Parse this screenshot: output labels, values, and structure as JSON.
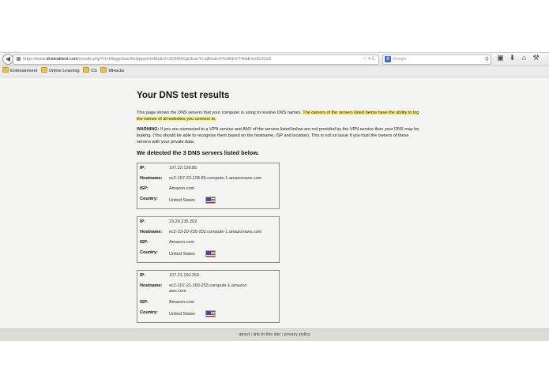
{
  "browser": {
    "url_prefix": "https://www.",
    "url_domain": "dnsleaktest.com",
    "url_rest": "/results.php?r1=DkpgeSacDw3qqswGeMz&r2=2D50HCgUEaoYLIqBtv&r3=fcbNHVT4tlaEms/GJCx0",
    "url_icons": "☆ ▾ C",
    "search_placeholder": "Google",
    "search_engine_letter": "8",
    "bookmarks": [
      "Entertainment",
      "Online Learning",
      "CS",
      "MHacks"
    ]
  },
  "page": {
    "title": "Your DNS test results",
    "intro_plain": "This page shows the DNS servers that your computer is using to resolve DNS names. ",
    "intro_highlight": "The owners of the servers listed below have the ability to log the names of all websites you connect to.",
    "warning_label": "WARNING:",
    "warning_text": " If you are connected to a VPN service and ANY of the servers listed below are not provided by the VPN service then your DNS may be leaking. (You should be able to recognise them based on the hostname, ISP and location). This is not an issue if you trust the owners of these servers with your private data.",
    "detected": "We detected the 3 DNS servers listed below.",
    "labels": {
      "ip": "IP:",
      "hostname": "Hostname:",
      "isp": "ISP:",
      "country": "Country:"
    },
    "servers": [
      {
        "ip": "107.22.128.85",
        "hostname": "ec2-107-22-128-85.compute-1.amazonaws.com",
        "isp": "Amazon.com",
        "country": "United States"
      },
      {
        "ip": "23.20.235.202",
        "hostname": "ec2-23-20-235-202.compute-1.amazonaws.com",
        "isp": "Amazon.com",
        "country": "United States"
      },
      {
        "ip": "107.21.160.253",
        "hostname": "ec2-107-21-160-253.compute-1.amazonaws.com",
        "isp": "Amazon.com",
        "country": "United States"
      }
    ]
  },
  "footer": {
    "about": "about",
    "link": "link to this site",
    "privacy": "privacy policy",
    "separator": "|"
  }
}
